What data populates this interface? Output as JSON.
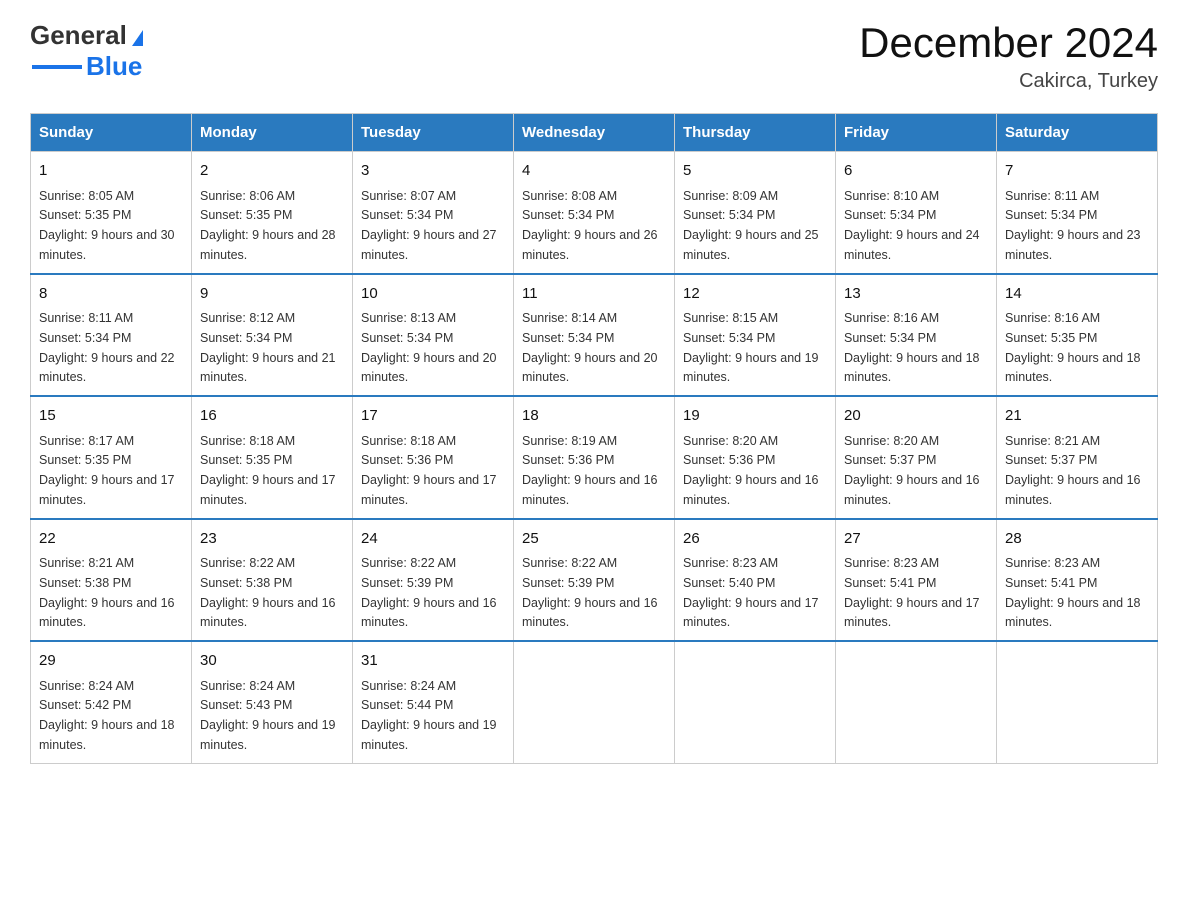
{
  "logo": {
    "line1": "General",
    "line2": "Blue",
    "arrow": "▶"
  },
  "title": "December 2024",
  "subtitle": "Cakirca, Turkey",
  "days_header": [
    "Sunday",
    "Monday",
    "Tuesday",
    "Wednesday",
    "Thursday",
    "Friday",
    "Saturday"
  ],
  "weeks": [
    [
      {
        "day": "1",
        "sunrise": "8:05 AM",
        "sunset": "5:35 PM",
        "daylight": "9 hours and 30 minutes."
      },
      {
        "day": "2",
        "sunrise": "8:06 AM",
        "sunset": "5:35 PM",
        "daylight": "9 hours and 28 minutes."
      },
      {
        "day": "3",
        "sunrise": "8:07 AM",
        "sunset": "5:34 PM",
        "daylight": "9 hours and 27 minutes."
      },
      {
        "day": "4",
        "sunrise": "8:08 AM",
        "sunset": "5:34 PM",
        "daylight": "9 hours and 26 minutes."
      },
      {
        "day": "5",
        "sunrise": "8:09 AM",
        "sunset": "5:34 PM",
        "daylight": "9 hours and 25 minutes."
      },
      {
        "day": "6",
        "sunrise": "8:10 AM",
        "sunset": "5:34 PM",
        "daylight": "9 hours and 24 minutes."
      },
      {
        "day": "7",
        "sunrise": "8:11 AM",
        "sunset": "5:34 PM",
        "daylight": "9 hours and 23 minutes."
      }
    ],
    [
      {
        "day": "8",
        "sunrise": "8:11 AM",
        "sunset": "5:34 PM",
        "daylight": "9 hours and 22 minutes."
      },
      {
        "day": "9",
        "sunrise": "8:12 AM",
        "sunset": "5:34 PM",
        "daylight": "9 hours and 21 minutes."
      },
      {
        "day": "10",
        "sunrise": "8:13 AM",
        "sunset": "5:34 PM",
        "daylight": "9 hours and 20 minutes."
      },
      {
        "day": "11",
        "sunrise": "8:14 AM",
        "sunset": "5:34 PM",
        "daylight": "9 hours and 20 minutes."
      },
      {
        "day": "12",
        "sunrise": "8:15 AM",
        "sunset": "5:34 PM",
        "daylight": "9 hours and 19 minutes."
      },
      {
        "day": "13",
        "sunrise": "8:16 AM",
        "sunset": "5:34 PM",
        "daylight": "9 hours and 18 minutes."
      },
      {
        "day": "14",
        "sunrise": "8:16 AM",
        "sunset": "5:35 PM",
        "daylight": "9 hours and 18 minutes."
      }
    ],
    [
      {
        "day": "15",
        "sunrise": "8:17 AM",
        "sunset": "5:35 PM",
        "daylight": "9 hours and 17 minutes."
      },
      {
        "day": "16",
        "sunrise": "8:18 AM",
        "sunset": "5:35 PM",
        "daylight": "9 hours and 17 minutes."
      },
      {
        "day": "17",
        "sunrise": "8:18 AM",
        "sunset": "5:36 PM",
        "daylight": "9 hours and 17 minutes."
      },
      {
        "day": "18",
        "sunrise": "8:19 AM",
        "sunset": "5:36 PM",
        "daylight": "9 hours and 16 minutes."
      },
      {
        "day": "19",
        "sunrise": "8:20 AM",
        "sunset": "5:36 PM",
        "daylight": "9 hours and 16 minutes."
      },
      {
        "day": "20",
        "sunrise": "8:20 AM",
        "sunset": "5:37 PM",
        "daylight": "9 hours and 16 minutes."
      },
      {
        "day": "21",
        "sunrise": "8:21 AM",
        "sunset": "5:37 PM",
        "daylight": "9 hours and 16 minutes."
      }
    ],
    [
      {
        "day": "22",
        "sunrise": "8:21 AM",
        "sunset": "5:38 PM",
        "daylight": "9 hours and 16 minutes."
      },
      {
        "day": "23",
        "sunrise": "8:22 AM",
        "sunset": "5:38 PM",
        "daylight": "9 hours and 16 minutes."
      },
      {
        "day": "24",
        "sunrise": "8:22 AM",
        "sunset": "5:39 PM",
        "daylight": "9 hours and 16 minutes."
      },
      {
        "day": "25",
        "sunrise": "8:22 AM",
        "sunset": "5:39 PM",
        "daylight": "9 hours and 16 minutes."
      },
      {
        "day": "26",
        "sunrise": "8:23 AM",
        "sunset": "5:40 PM",
        "daylight": "9 hours and 17 minutes."
      },
      {
        "day": "27",
        "sunrise": "8:23 AM",
        "sunset": "5:41 PM",
        "daylight": "9 hours and 17 minutes."
      },
      {
        "day": "28",
        "sunrise": "8:23 AM",
        "sunset": "5:41 PM",
        "daylight": "9 hours and 18 minutes."
      }
    ],
    [
      {
        "day": "29",
        "sunrise": "8:24 AM",
        "sunset": "5:42 PM",
        "daylight": "9 hours and 18 minutes."
      },
      {
        "day": "30",
        "sunrise": "8:24 AM",
        "sunset": "5:43 PM",
        "daylight": "9 hours and 19 minutes."
      },
      {
        "day": "31",
        "sunrise": "8:24 AM",
        "sunset": "5:44 PM",
        "daylight": "9 hours and 19 minutes."
      },
      null,
      null,
      null,
      null
    ]
  ]
}
